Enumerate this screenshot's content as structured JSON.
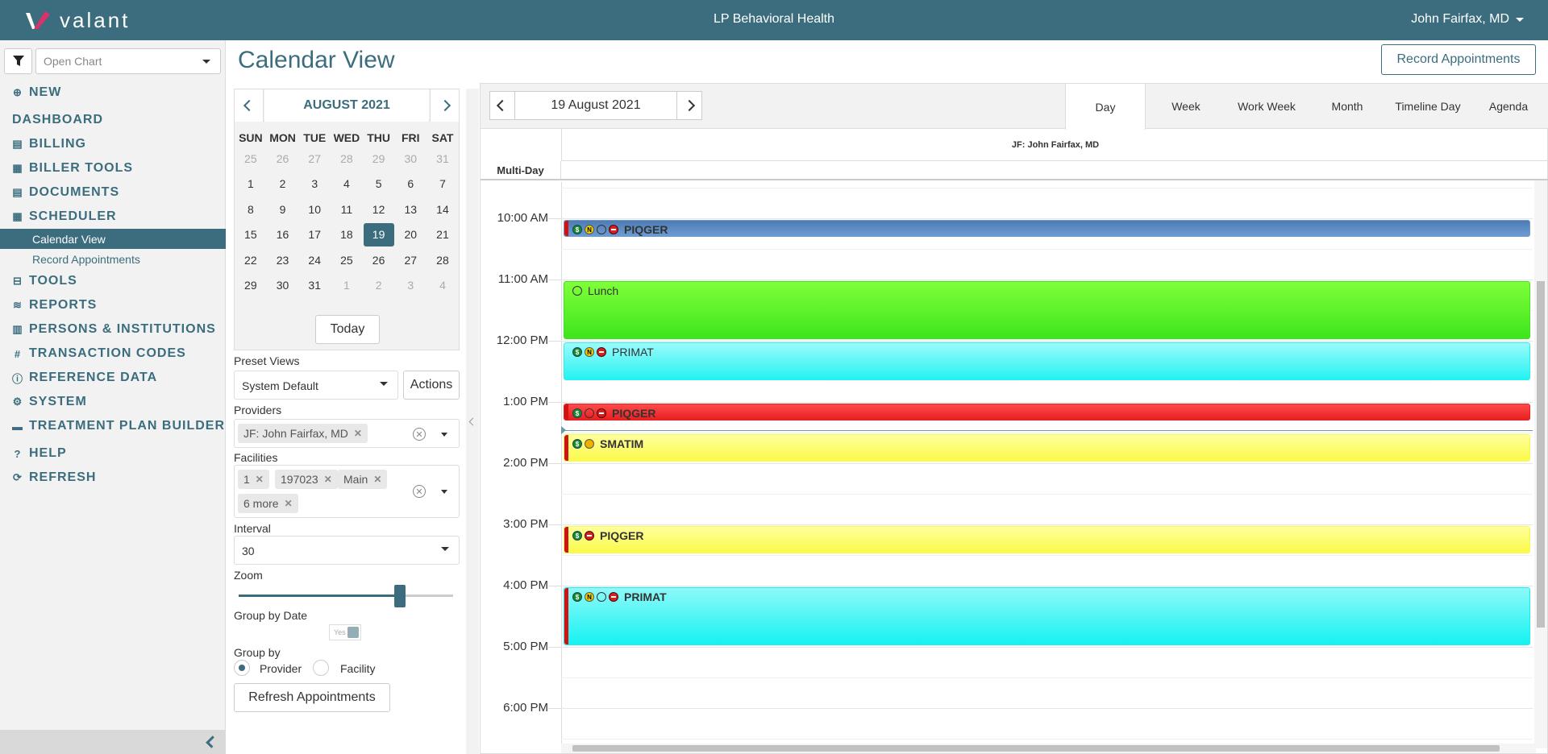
{
  "app": {
    "logo_text": "valant",
    "org_title": "LP Behavioral Health",
    "user_name": "John Fairfax, MD"
  },
  "sidebar": {
    "open_chart_placeholder": "Open Chart",
    "items": [
      {
        "label": "NEW",
        "icon": "plus-circle-icon"
      },
      {
        "label": "DASHBOARD",
        "icon": ""
      },
      {
        "label": "BILLING",
        "icon": "file-icon"
      },
      {
        "label": "BILLER TOOLS",
        "icon": "calculator-icon"
      },
      {
        "label": "DOCUMENTS",
        "icon": "file-icon"
      },
      {
        "label": "SCHEDULER",
        "icon": "calendar-icon"
      },
      {
        "label": "Calendar View",
        "sub": true,
        "active": true
      },
      {
        "label": "Record Appointments",
        "sub": true
      },
      {
        "label": "TOOLS",
        "icon": "toolbox-icon"
      },
      {
        "label": "REPORTS",
        "icon": "layers-icon"
      },
      {
        "label": "PERSONS & INSTITUTIONS",
        "icon": "building-icon"
      },
      {
        "label": "TRANSACTION CODES",
        "icon": "hash-icon"
      },
      {
        "label": "REFERENCE DATA",
        "icon": "info-icon"
      },
      {
        "label": "SYSTEM",
        "icon": "cogs-icon"
      },
      {
        "label": "TREATMENT PLAN BUILDER",
        "icon": "folder-icon"
      },
      {
        "label": "HELP",
        "icon": "question-icon"
      },
      {
        "label": "REFRESH",
        "icon": "refresh-icon"
      }
    ]
  },
  "page": {
    "title": "Calendar View",
    "record_button": "Record Appointments"
  },
  "minical": {
    "month_label": "AUGUST 2021",
    "dow": [
      "SUN",
      "MON",
      "TUE",
      "WED",
      "THU",
      "FRI",
      "SAT"
    ],
    "weeks": [
      [
        {
          "d": "25",
          "m": true
        },
        {
          "d": "26",
          "m": true
        },
        {
          "d": "27",
          "m": true
        },
        {
          "d": "28",
          "m": true
        },
        {
          "d": "29",
          "m": true
        },
        {
          "d": "30",
          "m": true
        },
        {
          "d": "31",
          "m": true
        }
      ],
      [
        {
          "d": "1"
        },
        {
          "d": "2"
        },
        {
          "d": "3"
        },
        {
          "d": "4"
        },
        {
          "d": "5"
        },
        {
          "d": "6"
        },
        {
          "d": "7"
        }
      ],
      [
        {
          "d": "8"
        },
        {
          "d": "9"
        },
        {
          "d": "10"
        },
        {
          "d": "11"
        },
        {
          "d": "12"
        },
        {
          "d": "13"
        },
        {
          "d": "14"
        }
      ],
      [
        {
          "d": "15"
        },
        {
          "d": "16"
        },
        {
          "d": "17"
        },
        {
          "d": "18"
        },
        {
          "d": "19",
          "sel": true
        },
        {
          "d": "20"
        },
        {
          "d": "21"
        }
      ],
      [
        {
          "d": "22"
        },
        {
          "d": "23"
        },
        {
          "d": "24"
        },
        {
          "d": "25"
        },
        {
          "d": "26"
        },
        {
          "d": "27"
        },
        {
          "d": "28"
        }
      ],
      [
        {
          "d": "29"
        },
        {
          "d": "30"
        },
        {
          "d": "31"
        },
        {
          "d": "1",
          "m": true
        },
        {
          "d": "2",
          "m": true
        },
        {
          "d": "3",
          "m": true
        },
        {
          "d": "4",
          "m": true
        }
      ]
    ],
    "today_label": "Today"
  },
  "filters": {
    "preset_views_label": "Preset Views",
    "preset_views_value": "System Default",
    "actions_label": "Actions",
    "providers_label": "Providers",
    "provider_tags": [
      "JF: John Fairfax, MD"
    ],
    "facilities_label": "Facilities",
    "facility_tags": [
      "1",
      "197023",
      "Main",
      "6 more"
    ],
    "interval_label": "Interval",
    "interval_value": "30",
    "zoom_label": "Zoom",
    "zoom_fraction": 0.75,
    "group_by_date_label": "Group by Date",
    "group_by_date_toggle": "Yes",
    "group_by_label": "Group by",
    "group_by_options": [
      "Provider",
      "Facility"
    ],
    "group_by_selected": "Provider",
    "refresh_label": "Refresh Appointments"
  },
  "scheduler": {
    "date_label": "19 August 2021",
    "views": [
      "Day",
      "Week",
      "Work Week",
      "Month",
      "Timeline Day",
      "Agenda"
    ],
    "active_view": "Day",
    "resource": "JF: John Fairfax, MD",
    "multi_day_label": "Multi-Day",
    "times": [
      "10:00 AM",
      "11:00 AM",
      "12:00 PM",
      "1:00 PM",
      "2:00 PM",
      "3:00 PM",
      "4:00 PM",
      "5:00 PM",
      "6:00 PM"
    ],
    "appointments": [
      {
        "title": "PIQGER",
        "bold": true,
        "start": "10:00",
        "end": "10:20",
        "icons": [
          "dollar-icon",
          "n-icon",
          "cycle-icon",
          "no-entry-icon"
        ],
        "color": "#6d9bd1",
        "color2": "#4d7bb5",
        "bar": true
      },
      {
        "title": "Lunch",
        "bold": false,
        "start": "11:00",
        "end": "12:00",
        "icons": [
          "cycle-icon"
        ],
        "color": "#3ee51d",
        "color2": "#7fff3a",
        "bar": false
      },
      {
        "title": "PRIMAT",
        "bold": false,
        "start": "12:00",
        "end": "12:40",
        "icons": [
          "dollar-icon",
          "n-icon",
          "no-entry-icon"
        ],
        "color": "#24f2f2",
        "color2": "#9afbfb",
        "bar": false
      },
      {
        "title": "PIQGER",
        "bold": true,
        "start": "13:00",
        "end": "13:20",
        "icons": [
          "dollar-icon",
          "cycle-icon",
          "no-entry-icon"
        ],
        "color": "#e82020",
        "color2": "#ff4a4a",
        "bar": true
      },
      {
        "title": "SMATIM",
        "bold": true,
        "start": "13:30",
        "end": "14:00",
        "icons": [
          "dollar-icon",
          "o-icon"
        ],
        "color": "#fafa4a",
        "color2": "#ffff9c",
        "bar": true
      },
      {
        "title": "PIQGER",
        "bold": true,
        "start": "15:00",
        "end": "15:30",
        "icons": [
          "dollar-icon",
          "no-entry-icon"
        ],
        "color": "#fafa4a",
        "color2": "#ffff9c",
        "bar": true
      },
      {
        "title": "PRIMAT",
        "bold": true,
        "start": "16:00",
        "end": "17:00",
        "icons": [
          "dollar-icon",
          "n-icon",
          "cycle-icon",
          "no-entry-icon"
        ],
        "color": "#16f2f2",
        "color2": "#8ef9f9",
        "bar": true
      }
    ]
  }
}
